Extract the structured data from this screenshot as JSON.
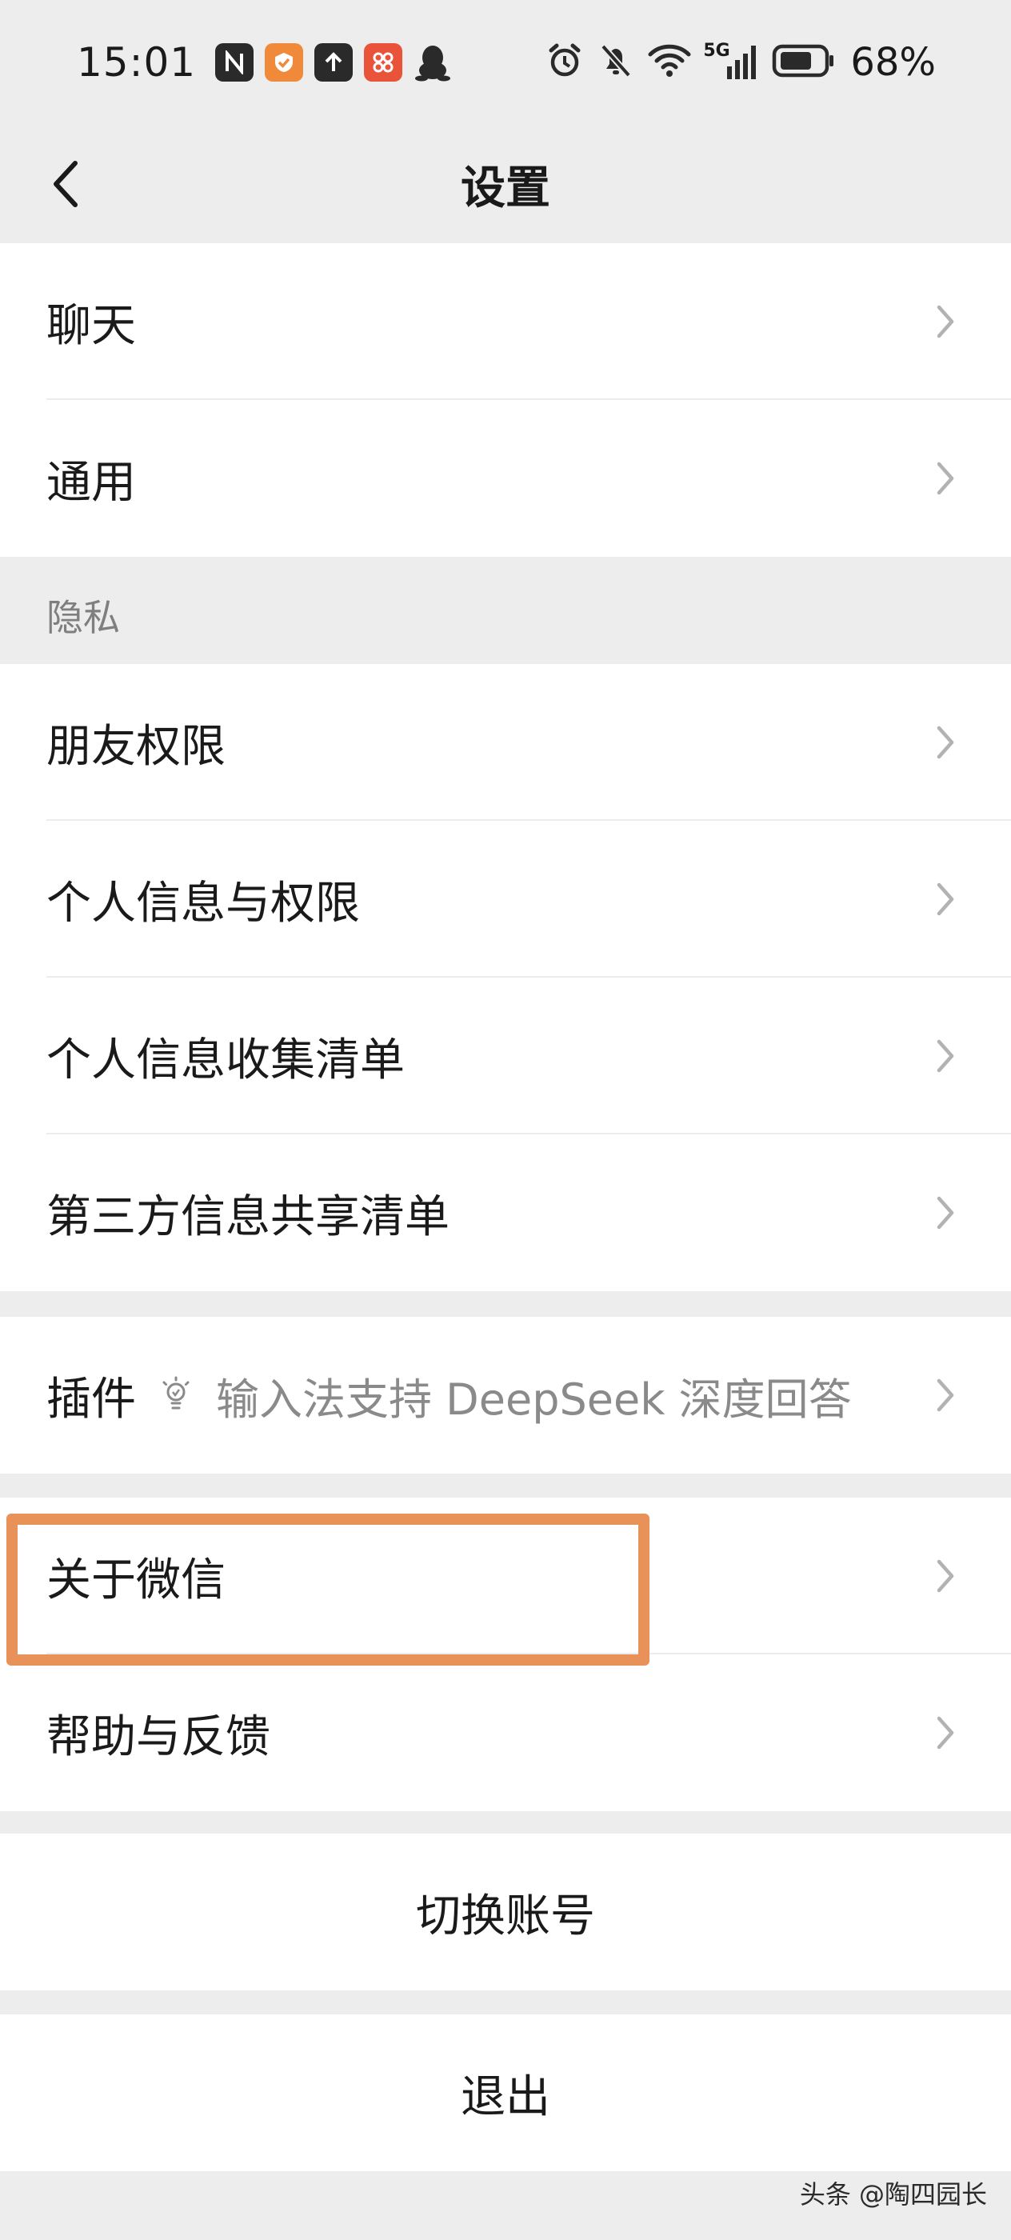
{
  "status_bar": {
    "time": "15:01",
    "battery": "68%",
    "network": "5G"
  },
  "nav": {
    "title": "设置"
  },
  "groups": {
    "top": [
      "聊天",
      "通用"
    ],
    "privacy_header": "隐私",
    "privacy": [
      "朋友权限",
      "个人信息与权限",
      "个人信息收集清单",
      "第三方信息共享清单"
    ],
    "plugin_label": "插件",
    "plugin_tip": "输入法支持 DeepSeek 深度回答",
    "about": "关于微信",
    "help": "帮助与反馈",
    "switch_account": "切换账号",
    "logout": "退出"
  },
  "highlight_color": "#e8925a",
  "watermark": "头条 @陶四园长"
}
